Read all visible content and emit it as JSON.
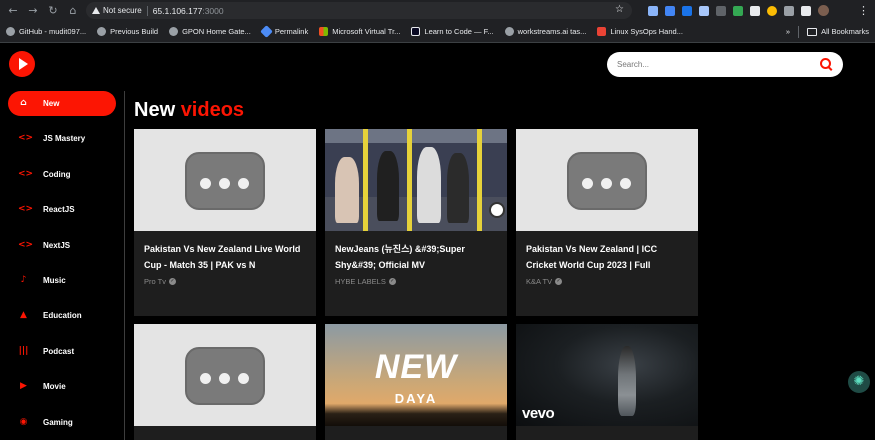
{
  "browser": {
    "security_label": "Not secure",
    "url_host": "65.1.106.177",
    "url_port": ":3000",
    "bookmarks": [
      {
        "label": "GitHub - mudit097..."
      },
      {
        "label": "Previous Build"
      },
      {
        "label": "GPON Home Gate..."
      },
      {
        "label": "Permalink"
      },
      {
        "label": "Microsoft Virtual Tr..."
      },
      {
        "label": "Learn to Code — F..."
      },
      {
        "label": "workstreams.ai tas..."
      },
      {
        "label": "Linux SysOps Hand..."
      }
    ],
    "more_bookmarks": "»",
    "all_bookmarks": "All Bookmarks"
  },
  "app": {
    "accent_color": "#fc1503",
    "search_placeholder": "Search...",
    "categories": [
      {
        "label": "New",
        "icon": "home-icon",
        "glyph": "⌂"
      },
      {
        "label": "JS Mastery",
        "icon": "code-icon",
        "glyph": "<>"
      },
      {
        "label": "Coding",
        "icon": "code-icon",
        "glyph": "<>"
      },
      {
        "label": "ReactJS",
        "icon": "code-icon",
        "glyph": "<>"
      },
      {
        "label": "NextJS",
        "icon": "code-icon",
        "glyph": "<>"
      },
      {
        "label": "Music",
        "icon": "music-note-icon",
        "glyph": "♪"
      },
      {
        "label": "Education",
        "icon": "school-icon",
        "glyph": "▲"
      },
      {
        "label": "Podcast",
        "icon": "podcast-icon",
        "glyph": "|||"
      },
      {
        "label": "Movie",
        "icon": "movie-icon",
        "glyph": "▶"
      },
      {
        "label": "Gaming",
        "icon": "gamepad-icon",
        "glyph": "◉"
      }
    ],
    "feed_title_prefix": "New",
    "feed_title_highlight": "videos",
    "videos": [
      {
        "title": "Pakistan Vs New Zealand Live World Cup - Match 35 | PAK vs N",
        "channel": "Pro Tv"
      },
      {
        "title": "NewJeans (뉴진스) &#39;Super Shy&#39; Official MV",
        "channel": "HYBE LABELS"
      },
      {
        "title": "Pakistan Vs New Zealand | ICC Cricket World Cup 2023 | Full",
        "channel": "K&A TV"
      },
      {
        "title": "",
        "channel": ""
      },
      {
        "title": "",
        "channel": "",
        "thumb_text_1": "NEW",
        "thumb_text_2": "DAYA"
      },
      {
        "title": "",
        "channel": "",
        "thumb_logo": "vevo"
      }
    ]
  }
}
